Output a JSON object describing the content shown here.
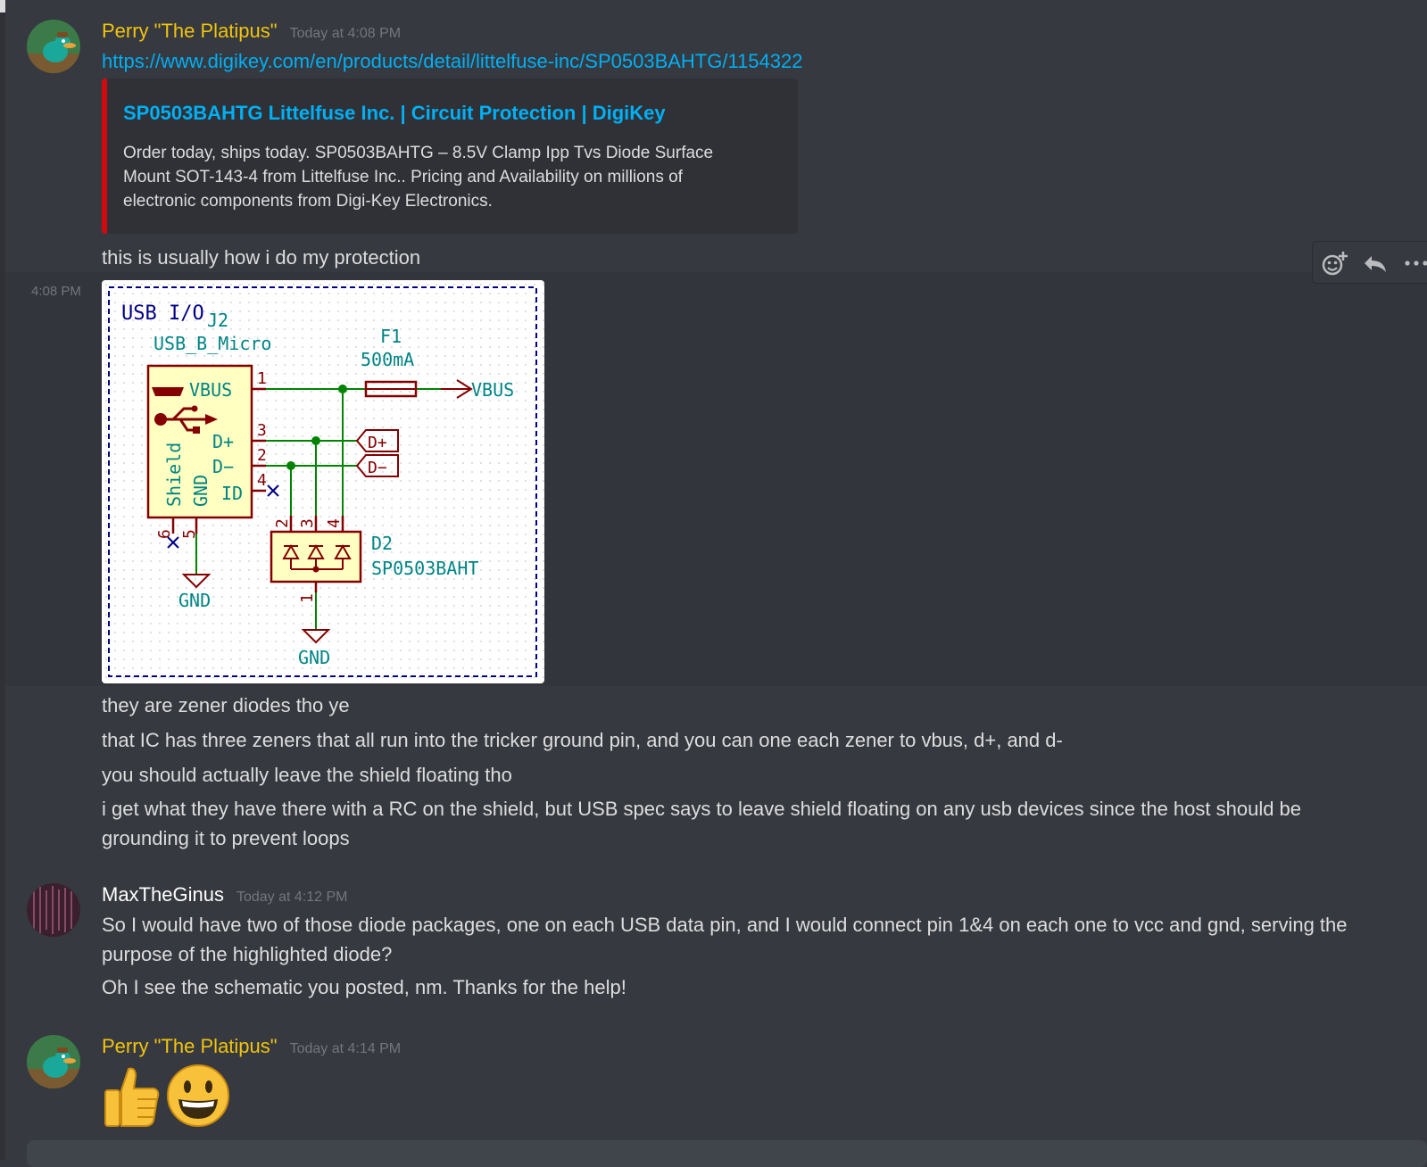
{
  "messages": {
    "perry1": {
      "username": "Perry \"The Platipus\"",
      "timestamp": "Today at 4:08 PM",
      "link": "https://www.digikey.com/en/products/detail/littelfuse-inc/SP0503BAHTG/1154322",
      "embed": {
        "title": "SP0503BAHTG Littelfuse Inc. | Circuit Protection | DigiKey",
        "description": "Order today, ships today. SP0503BAHTG – 8.5V Clamp Ipp Tvs Diode Surface Mount SOT-143-4 from Littelfuse Inc.. Pricing and Availability on millions of electronic components from Digi-Key Electronics.",
        "accent_color": "#d10a11"
      },
      "line1": "this is usually how i do my protection",
      "side_time": "4:08 PM",
      "line2": "they are zener diodes tho ye",
      "line3": "that IC has three zeners that all run into the tricker ground pin, and you can one each zener to vbus, d+, and d-",
      "line4": "you should actually leave the shield floating tho",
      "line5": "i get what they have there with a RC on the shield, but USB spec says to leave shield floating on any usb devices since the host should be grounding it to prevent loops"
    },
    "max": {
      "username": "MaxTheGinus",
      "timestamp": "Today at 4:12 PM",
      "line1": "So I would have two of those diode packages, one on each USB data pin, and I would connect pin 1&4 on each one to vcc and gnd, serving the purpose of the highlighted diode?",
      "line2": "Oh I see the schematic you posted, nm. Thanks for the help!"
    },
    "perry2": {
      "username": "Perry \"The Platipus\"",
      "timestamp": "Today at 4:14 PM",
      "emojis": [
        "thumbs-up",
        "smiley"
      ]
    }
  },
  "schematic": {
    "sheet_label": "USB I/O",
    "ref_j2": "J2",
    "j2_value": "USB_B_Micro",
    "f1_ref": "F1",
    "f1_value": "500mA",
    "vbus_label": "VBUS",
    "pin_vbus": "VBUS",
    "pin_dp": "D+",
    "pin_dm": "D−",
    "pin_id": "ID",
    "pin_shield": "Shield",
    "pin_gnd": "GND",
    "num1": "1",
    "num2": "2",
    "num3": "3",
    "num4": "4",
    "num5": "5",
    "num6": "6",
    "d2_num2": "2",
    "d2_num3": "3",
    "d2_num4": "4",
    "d2_num1": "1",
    "port_dp": "D+",
    "port_dm": "D−",
    "d2_ref": "D2",
    "d2_value": "SP0503BAHT",
    "gnd1": "GND",
    "gnd2": "GND"
  },
  "colors": {
    "background": "#36393f",
    "username_perry": "#f1c40f",
    "link": "#00aff4",
    "wire": "#008400",
    "component": "#840000",
    "text_teal": "#008484",
    "sheet_border": "#000084"
  },
  "icons": [
    "add-reaction-icon",
    "reply-icon",
    "more-icon"
  ]
}
